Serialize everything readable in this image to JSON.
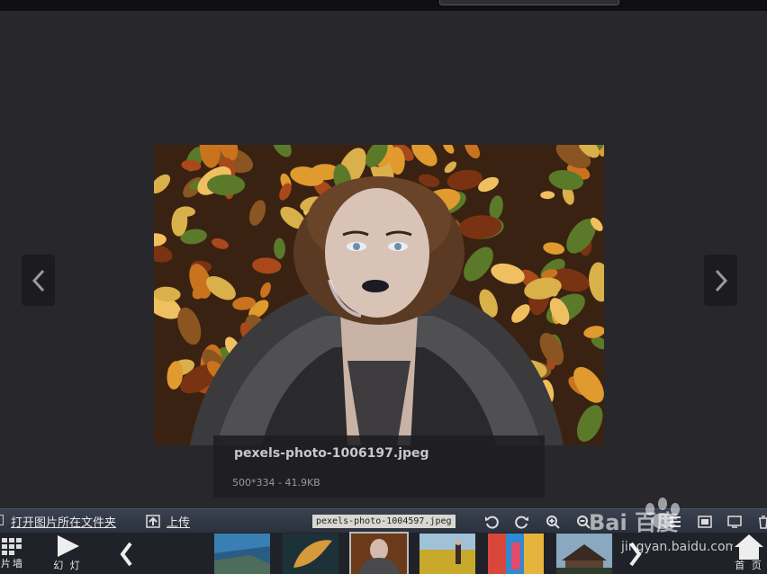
{
  "topbar": {
    "app_title": "",
    "sort_label": "",
    "search_placeholder": ""
  },
  "viewer": {
    "filename": "pexels-photo-1006197.jpeg",
    "meta": "500*334 - 41.9KB"
  },
  "toolbar": {
    "open_folder": "打开图片所在文件夹",
    "upload": "上传",
    "current_file": "pexels-photo-1004597.jpeg"
  },
  "filmstrip": {
    "photo_wall_label": "片墙",
    "slideshow_label": "幻 灯",
    "home_label": "首 页",
    "thumbnails": [
      {
        "name": "coast"
      },
      {
        "name": "leaf"
      },
      {
        "name": "portrait"
      },
      {
        "name": "field"
      },
      {
        "name": "graffiti"
      },
      {
        "name": "cabin"
      }
    ]
  },
  "watermark": {
    "brand": "Bai 百度",
    "site": "jingyan.baidu.com"
  },
  "colors": {
    "background": "#28272c",
    "toolbar": "#323845",
    "filmstrip": "#1f2329"
  }
}
